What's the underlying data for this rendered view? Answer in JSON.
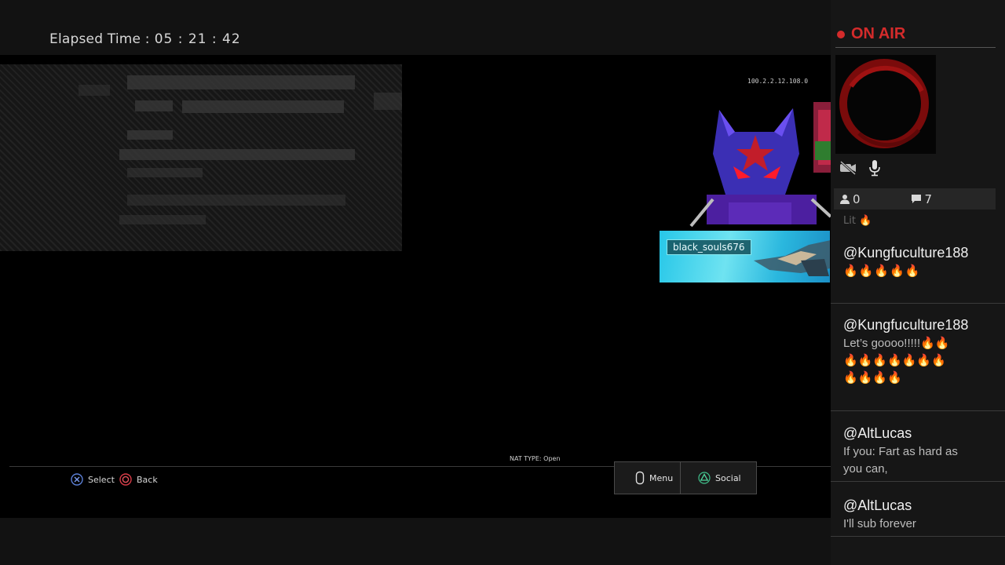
{
  "header": {
    "elapsed_label": "Elapsed Time :",
    "elapsed_value": "05 : 21 : 42"
  },
  "game": {
    "ip_address": "100.2.2.12.108.0",
    "gamertag": "black_souls676",
    "nat_type": "NAT TYPE: Open",
    "controls": {
      "select_label": "Select",
      "back_label": "Back",
      "menu_label": "Menu",
      "social_label": "Social"
    }
  },
  "broadcast": {
    "status_label": "ON AIR",
    "viewer_count": "0",
    "comment_count": "7",
    "colors": {
      "on_air": "#d42b2b",
      "emoji": "#f3a21d"
    }
  },
  "chat": {
    "peek_text": "Lit 🔥",
    "messages": [
      {
        "user": "@Kungfuculture188",
        "text": "🔥🔥🔥🔥🔥"
      },
      {
        "user": "@Kungfuculture188",
        "text": "Let’s goooo!!!!!🔥🔥🔥🔥🔥🔥🔥🔥🔥🔥🔥🔥🔥"
      },
      {
        "user": "@AltLucas",
        "text": "If you: Fart as hard as you can,"
      },
      {
        "user": "@AltLucas",
        "text": "I'll sub forever"
      }
    ]
  }
}
